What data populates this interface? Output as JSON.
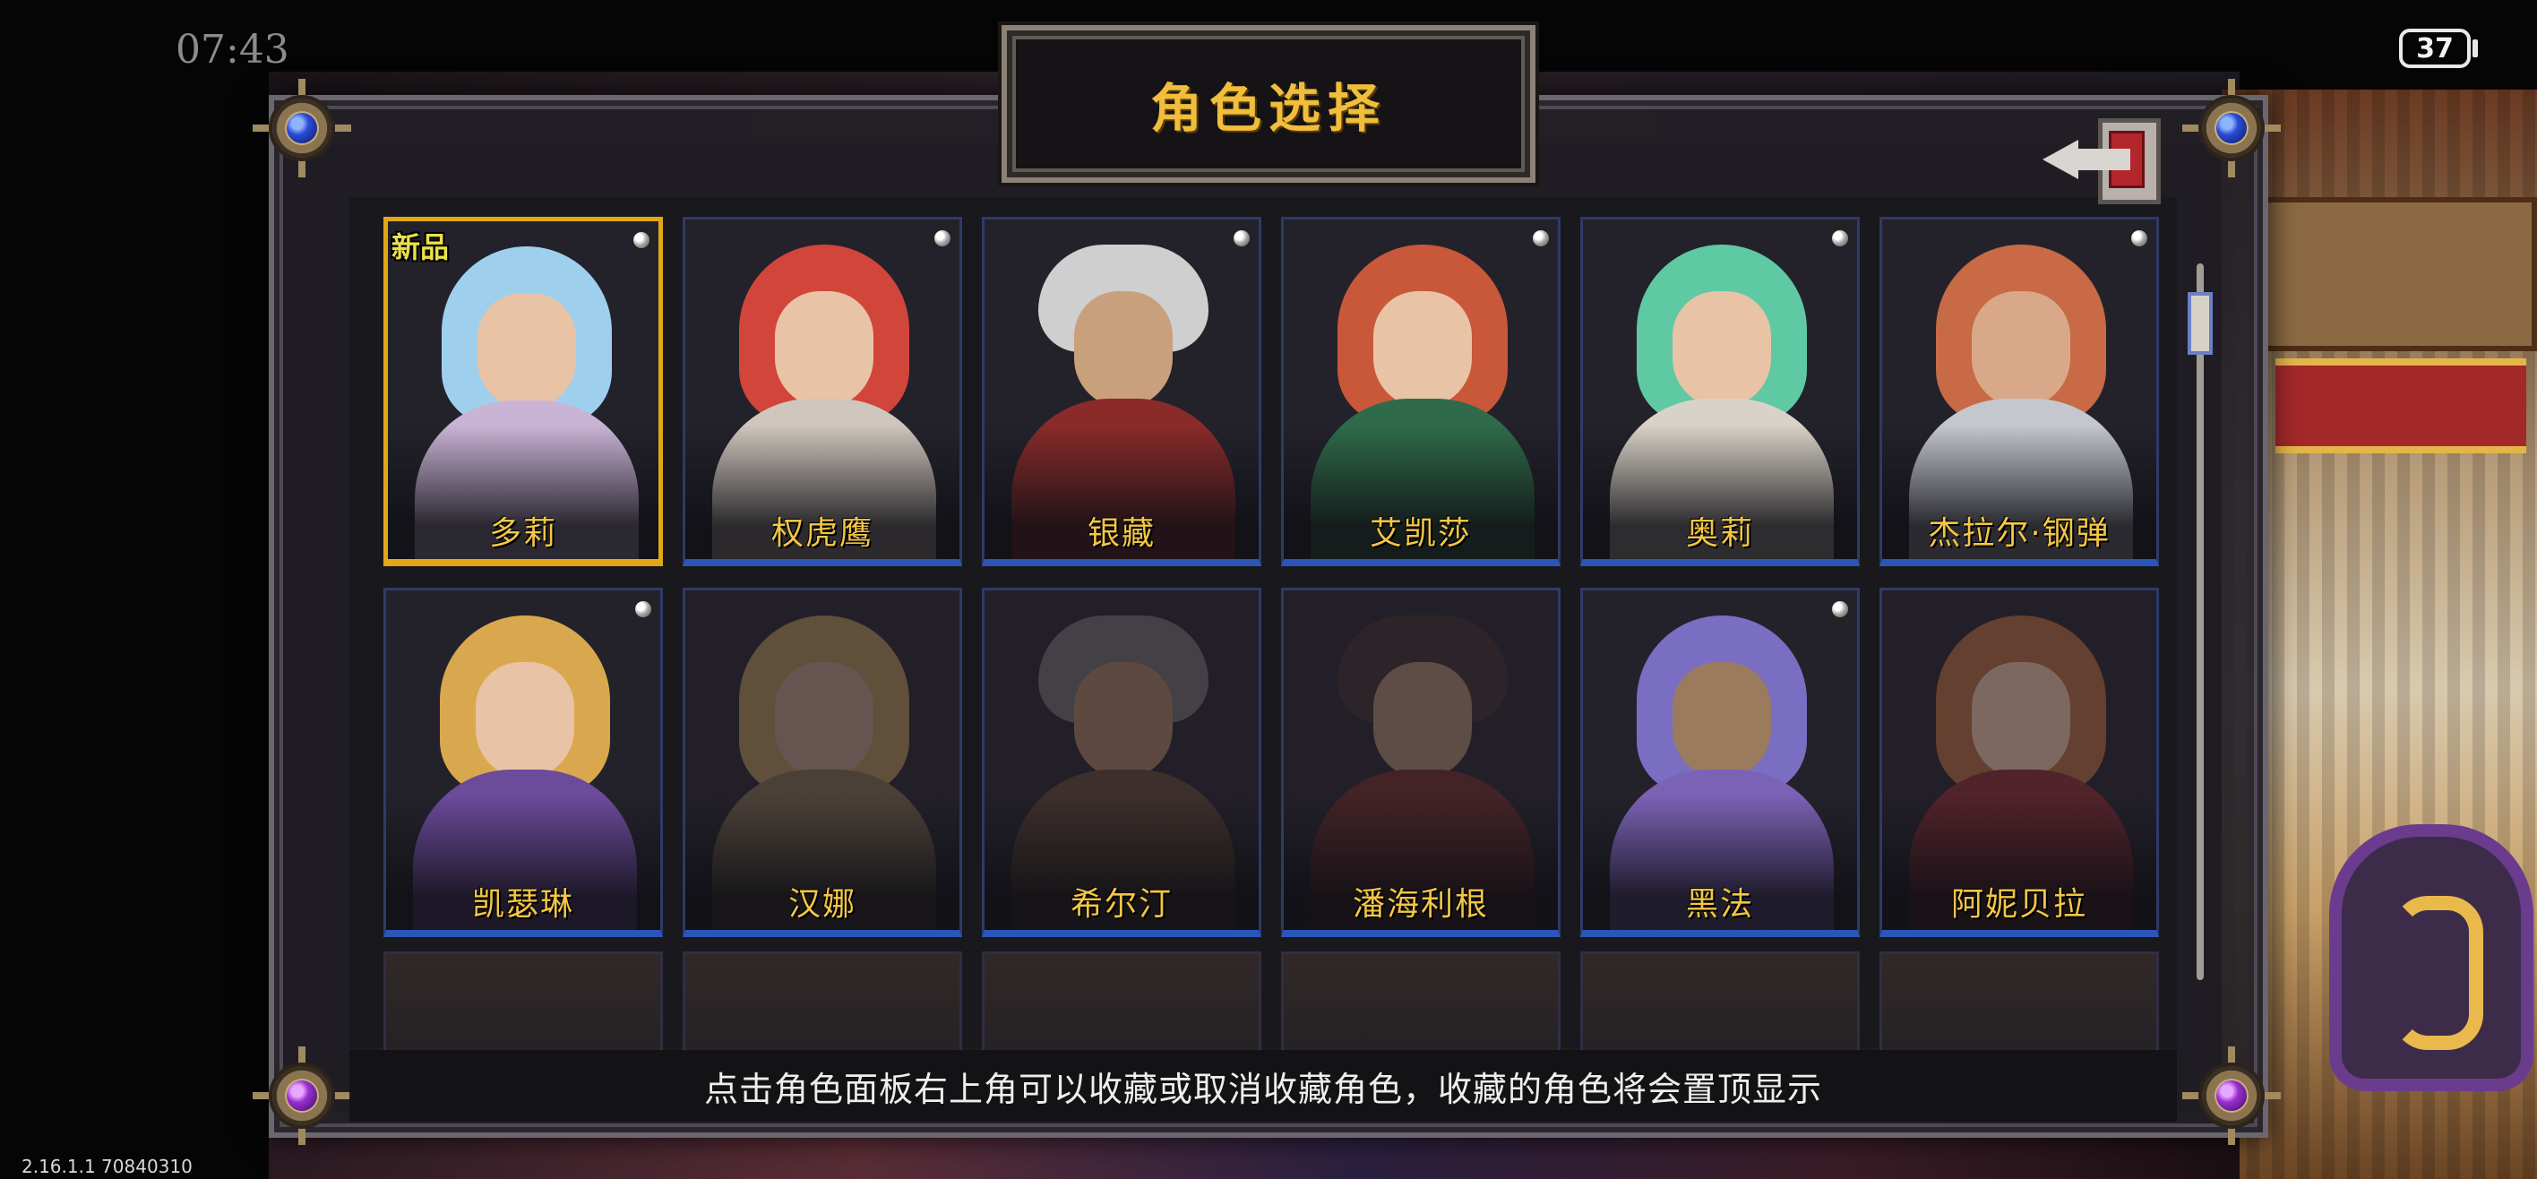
{
  "status_bar": {
    "time": "07:43",
    "battery": "37"
  },
  "version": "2.16.1.1 70840310",
  "header": {
    "title": "角色选择"
  },
  "back_button": {
    "icon": "exit-door-icon"
  },
  "characters": [
    {
      "name": "多莉",
      "new_badge": "新品",
      "selected": true,
      "locked": false,
      "favorite_pin": true
    },
    {
      "name": "权虎鹰",
      "selected": false,
      "locked": false,
      "favorite_pin": true
    },
    {
      "name": "银藏",
      "selected": false,
      "locked": false,
      "favorite_pin": true
    },
    {
      "name": "艾凯莎",
      "selected": false,
      "locked": false,
      "favorite_pin": true
    },
    {
      "name": "奥莉",
      "selected": false,
      "locked": false,
      "favorite_pin": true
    },
    {
      "name": "杰拉尔·钢弹",
      "selected": false,
      "locked": false,
      "favorite_pin": true
    },
    {
      "name": "凯瑟琳",
      "selected": false,
      "locked": false,
      "favorite_pin": true
    },
    {
      "name": "汉娜",
      "selected": false,
      "locked": true,
      "favorite_pin": false
    },
    {
      "name": "希尔汀",
      "selected": false,
      "locked": true,
      "favorite_pin": false
    },
    {
      "name": "潘海利根",
      "selected": false,
      "locked": true,
      "favorite_pin": false
    },
    {
      "name": "黑法",
      "selected": false,
      "locked": false,
      "favorite_pin": true
    },
    {
      "name": "阿妮贝拉",
      "selected": false,
      "locked": true,
      "favorite_pin": false
    }
  ],
  "hint": "点击角色面板右上角可以收藏或取消收藏角色，收藏的角色将会置顶显示",
  "colors": {
    "title_gold": "#f0bd3c",
    "name_gold": "#f3c646",
    "selected_border": "#e2a619",
    "card_border": "#2b56b8"
  }
}
